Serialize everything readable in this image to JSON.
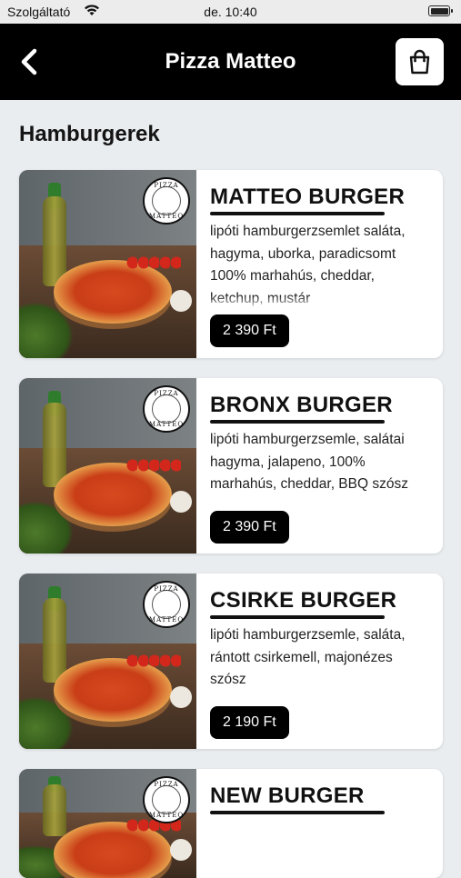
{
  "status_bar": {
    "carrier": "Szolgáltató",
    "time": "de. 10:40"
  },
  "nav": {
    "title": "Pizza Matteo"
  },
  "section": {
    "title": "Hamburgerek"
  },
  "logo_text": {
    "top": "PIZZA",
    "bottom": "MATTEO"
  },
  "products": [
    {
      "name": "MATTEO BURGER",
      "description": "lipóti hamburgerzsemlet saláta, hagyma, uborka, paradicsomt 100% marhahús, cheddar, ketchup, mustár",
      "price": "2 390 Ft"
    },
    {
      "name": "BRONX BURGER",
      "description": "lipóti hamburgerzsemle, salátai hagyma, jalapeno, 100% marhahús, cheddar, BBQ szósz",
      "price": "2 390 Ft"
    },
    {
      "name": "CSIRKE BURGER",
      "description": "lipóti hamburgerzsemle, saláta, rántott csirkemell, majonézes szósz",
      "price": "2 190 Ft"
    },
    {
      "name": "NEW BURGER",
      "description": "",
      "price": ""
    }
  ]
}
